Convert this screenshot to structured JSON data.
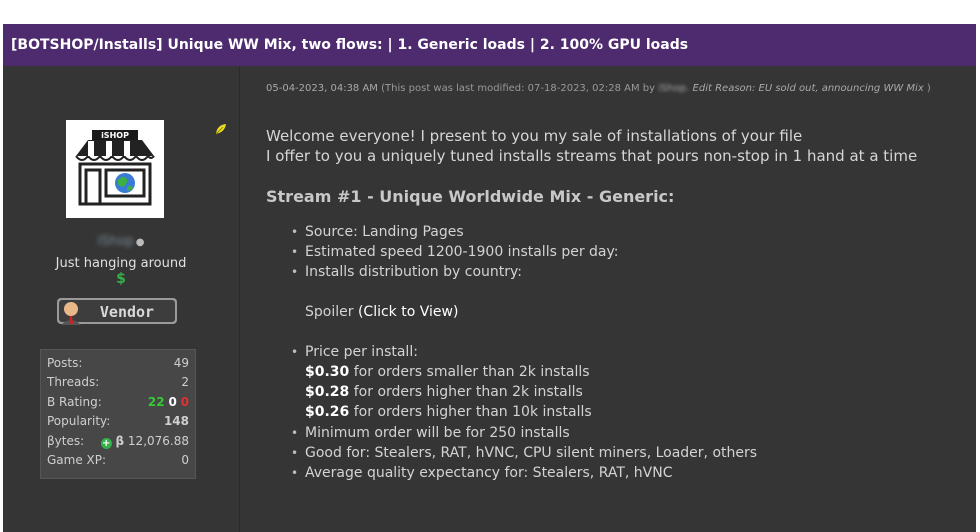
{
  "thread": {
    "title": "[BOTSHOP/Installs] Unique WW Mix, two flows: | 1. Generic loads | 2. 100% GPU loads"
  },
  "user": {
    "avatar_text": "iSHOP",
    "username": "iShop",
    "title": "Just hanging around",
    "dollar": "$",
    "badge_text": "Vendor",
    "stats": {
      "posts_label": "Posts:",
      "posts": "49",
      "threads_label": "Threads:",
      "threads": "2",
      "rating_label": "B Rating:",
      "rating_pos": "22",
      "rating_neu": "0",
      "rating_neg": "0",
      "popularity_label": "Popularity:",
      "popularity": "148",
      "bytes_label": "βytes:",
      "bytes_symbol": "β",
      "bytes": "12,076.88",
      "gamexp_label": "Game XP:",
      "gamexp": "0"
    }
  },
  "post": {
    "date": "05-04-2023, 04:38 AM",
    "modified_prefix": "(This post was last modified: 07-18-2023, 02:28 AM by",
    "modified_by": "iShop.",
    "edit_reason": "Edit Reason: EU sold out, announcing WW Mix",
    "modified_suffix": ")",
    "intro1": "Welcome everyone! I present to you my sale of installations of your file",
    "intro2": "I offer to you a uniquely tuned installs streams that pours non-stop in 1 hand at a time",
    "stream1_heading": "Stream #1 - Unique Worldwide Mix - Generic:",
    "bullets1": [
      "Source: Landing Pages",
      "Estimated speed 1200-1900 installs per day:",
      "Installs distribution by country:"
    ],
    "spoiler_label": "Spoiler",
    "spoiler_link": "(Click to View)",
    "price_label": "Price per install:",
    "prices": [
      {
        "price": "$0.30",
        "text": " for orders smaller than 2k installs"
      },
      {
        "price": "$0.28",
        "text": " for orders higher than 2k installs"
      },
      {
        "price": "$0.26",
        "text": " for orders higher than 10k installs"
      }
    ],
    "bullets2": [
      "Minimum order will be for 250 installs",
      "Good for: Stealers, RAT, hVNC, CPU silent miners, Loader, others",
      "Average quality expectancy for: Stealers, RAT, hVNC"
    ]
  }
}
